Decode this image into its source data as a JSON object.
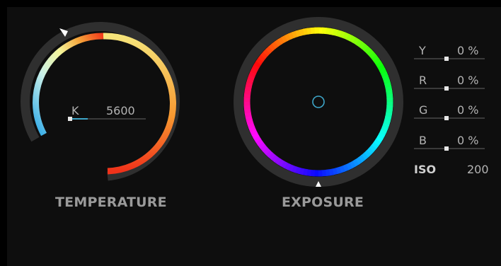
{
  "temperature": {
    "title": "TEMPERATURE",
    "unit_label": "K",
    "value": "5600"
  },
  "exposure": {
    "title": "EXPOSURE"
  },
  "channels": [
    {
      "label": "Y",
      "value": "0 %"
    },
    {
      "label": "R",
      "value": "0 %"
    },
    {
      "label": "G",
      "value": "0 %"
    },
    {
      "label": "B",
      "value": "0 %"
    }
  ],
  "iso": {
    "label": "ISO",
    "value": "200"
  },
  "colors": {
    "background": "#0e0e0e",
    "ring": "#2f2f2f",
    "accent": "#3ea6c9"
  }
}
